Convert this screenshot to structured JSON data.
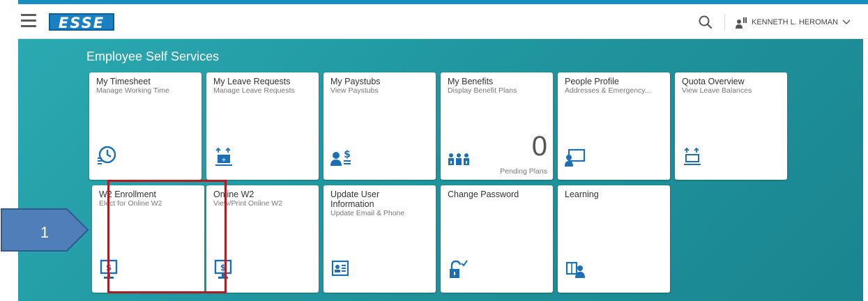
{
  "header": {
    "logo_text": "ESSE",
    "user_name": "KENNETH L. HEROMAN"
  },
  "section_title": "Employee Self Services",
  "tiles": [
    {
      "title": "My Timesheet",
      "subtitle": "Manage Working Time",
      "icon": "clock-list-icon"
    },
    {
      "title": "My Leave Requests",
      "subtitle": "Manage Leave Requests",
      "icon": "leave-request-icon"
    },
    {
      "title": "My Paystubs",
      "subtitle": "View Paystubs",
      "icon": "person-dollar-icon"
    },
    {
      "title": "My Benefits",
      "subtitle": "Display Benefit Plans",
      "icon": "group-benefits-icon",
      "count": "0",
      "footer": "Pending Plans"
    },
    {
      "title": "People Profile",
      "subtitle": "Addresses & Emergency...",
      "icon": "person-screen-icon"
    },
    {
      "title": "Quota Overview",
      "subtitle": "View Leave Balances",
      "icon": "leave-balance-icon"
    },
    {
      "title": "W2 Enrollment",
      "subtitle": "Elect for Online W2",
      "icon": "monitor-dollar-icon"
    },
    {
      "title": "Online W2",
      "subtitle": "View/Print Online W2",
      "icon": "monitor-dollar-icon"
    },
    {
      "title": "Update User Information",
      "subtitle": "Update Email & Phone",
      "icon": "id-card-icon"
    },
    {
      "title": "Change Password",
      "subtitle": "",
      "icon": "unlock-check-icon"
    },
    {
      "title": "Learning",
      "subtitle": "",
      "icon": "book-person-icon"
    }
  ],
  "callout": {
    "number": "1",
    "fill": "#4f7eb8",
    "border": "#2f5a8f"
  },
  "colors": {
    "teal": "#20969f",
    "icon_blue": "#1b6fb5",
    "highlight": "#b01c24"
  }
}
